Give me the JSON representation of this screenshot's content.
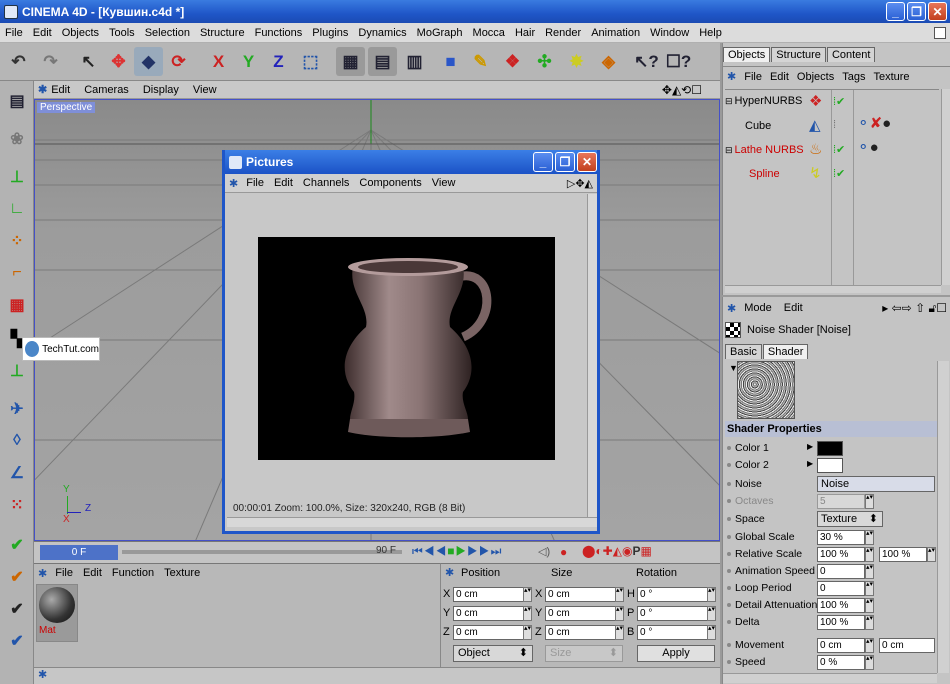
{
  "window": {
    "title": "CINEMA 4D - [Кувшин.c4d *]",
    "min": "_",
    "max": "❐",
    "close": "✕"
  },
  "menu": [
    "File",
    "Edit",
    "Objects",
    "Tools",
    "Selection",
    "Structure",
    "Functions",
    "Plugins",
    "Dynamics",
    "MoGraph",
    "Mocca",
    "Hair",
    "Render",
    "Animation",
    "Window",
    "Help"
  ],
  "viewport": {
    "menu": [
      "Edit",
      "Cameras",
      "Display",
      "View"
    ],
    "label": "Perspective",
    "axis_y": "Y",
    "axis_z": "Z",
    "axis_x": "X",
    "watermark": "TechTut.com",
    "nav_icons": "✥◭⟲☐"
  },
  "pictures": {
    "title": "Pictures",
    "menu": [
      "File",
      "Edit",
      "Channels",
      "Components",
      "View"
    ],
    "status": "00:00:01  Zoom: 100.0%, Size: 320x240, RGB (8 Bit)"
  },
  "timeline": {
    "start": "0 F",
    "end": "90 F"
  },
  "materials": {
    "menu": [
      "File",
      "Edit",
      "Function",
      "Texture"
    ],
    "mat_label": "Mat"
  },
  "coords": {
    "headers": [
      "Position",
      "Size",
      "Rotation"
    ],
    "rows": [
      {
        "a": "X",
        "av": "0 cm",
        "b": "X",
        "bv": "0 cm",
        "c": "H",
        "cv": "0 °"
      },
      {
        "a": "Y",
        "av": "0 cm",
        "b": "Y",
        "bv": "0 cm",
        "c": "P",
        "cv": "0 °"
      },
      {
        "a": "Z",
        "av": "0 cm",
        "b": "Z",
        "bv": "0 cm",
        "c": "B",
        "cv": "0 °"
      }
    ],
    "mode": "Object",
    "size_mode": "Size",
    "apply": "Apply"
  },
  "objects": {
    "tabs": [
      "Objects",
      "Structure",
      "Content"
    ],
    "menu": [
      "File",
      "Edit",
      "Objects",
      "Tags",
      "Texture"
    ],
    "tree": [
      {
        "name": "HyperNURBS",
        "color": "#000000"
      },
      {
        "name": "Cube",
        "color": "#000000"
      },
      {
        "name": "Lathe NURBS",
        "color": "#c00000"
      },
      {
        "name": "Spline",
        "color": "#c00000"
      }
    ]
  },
  "attributes": {
    "menu": [
      "Mode",
      "Edit"
    ],
    "shader_title": "Noise Shader [Noise]",
    "tabs": [
      "Basic",
      "Shader"
    ],
    "section": "Shader Properties",
    "props": [
      {
        "label": "Color 1",
        "type": "color",
        "value": "#000000"
      },
      {
        "label": "Color 2",
        "type": "color",
        "value": "#ffffff"
      },
      {
        "label": "Noise",
        "type": "select",
        "value": "Noise"
      },
      {
        "label": "Octaves",
        "type": "num",
        "value": "5",
        "disabled": true
      },
      {
        "label": "Space",
        "type": "select",
        "value": "Texture"
      },
      {
        "label": "Global Scale",
        "type": "num",
        "value": "30 %"
      },
      {
        "label": "Relative Scale",
        "type": "num3",
        "value": "100 %",
        "value2": "100 %"
      },
      {
        "label": "Animation Speed",
        "type": "num",
        "value": "0"
      },
      {
        "label": "Loop Period",
        "type": "num",
        "value": "0"
      },
      {
        "label": "Detail Attenuation",
        "type": "num",
        "value": "100 %"
      },
      {
        "label": "Delta",
        "type": "num",
        "value": "100 %"
      },
      {
        "label": "Movement",
        "type": "num3",
        "value": "0 cm",
        "value2": "0 cm"
      },
      {
        "label": "Speed",
        "type": "num",
        "value": "0 %"
      }
    ]
  }
}
